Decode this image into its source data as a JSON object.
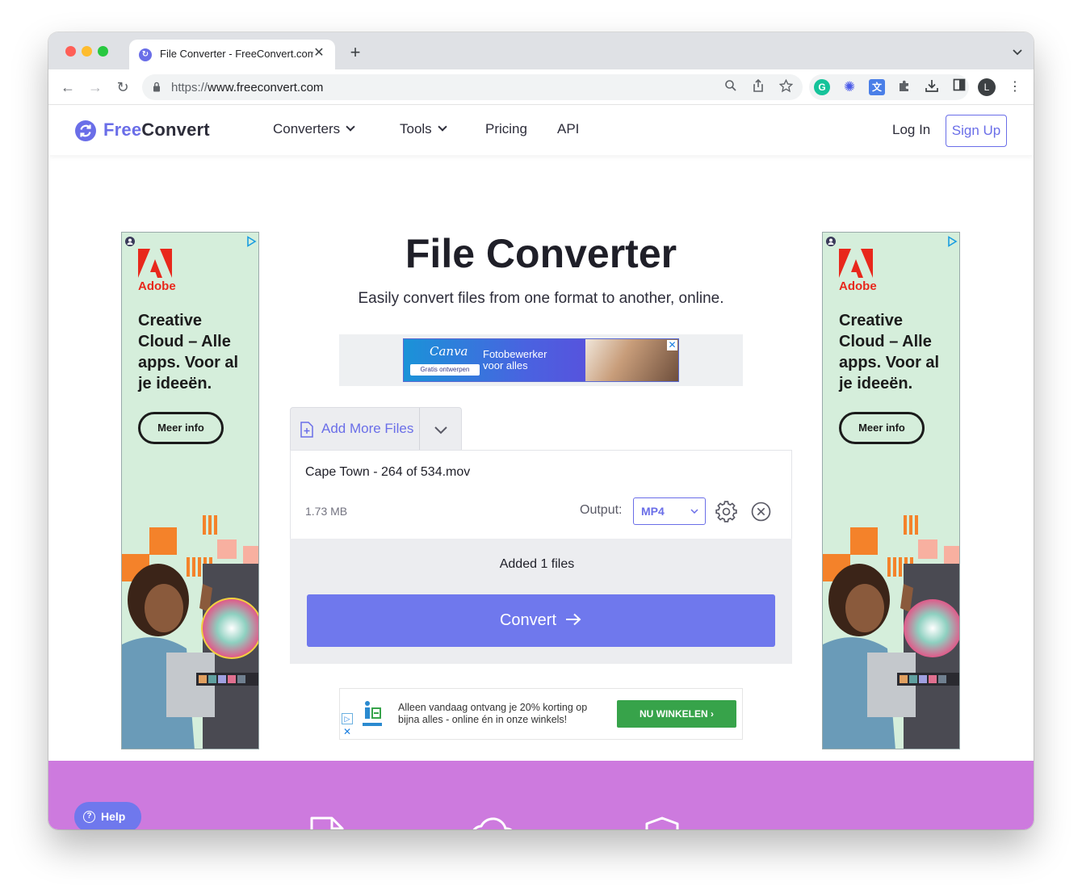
{
  "browser": {
    "tab_title": "File Converter - FreeConvert.com",
    "url_scheme": "https://",
    "url_host": "www.freeconvert.com",
    "avatar_initial": "L"
  },
  "header": {
    "logo_free": "Free",
    "logo_convert": "Convert",
    "nav": {
      "converters": "Converters",
      "tools": "Tools",
      "pricing": "Pricing",
      "api": "API"
    },
    "login": "Log In",
    "signup": "Sign Up"
  },
  "hero": {
    "title": "File Converter",
    "subtitle": "Easily convert files from one format to another, online."
  },
  "top_banner_ad": {
    "brand": "Canva",
    "badge": "Gratis ontwerpen",
    "line1": "Fotobewerker",
    "line2": "voor alles"
  },
  "side_ad": {
    "brand": "Adobe",
    "headline": "Creative Cloud – Alle apps. Voor al je ideeën.",
    "cta": "Meer info"
  },
  "converter": {
    "add_more_label": "Add More Files",
    "file_name": "Cape Town - 264 of 534.mov",
    "file_size": "1.73 MB",
    "output_label": "Output:",
    "output_value": "MP4",
    "added_text": "Added 1 files",
    "convert_label": "Convert"
  },
  "bottom_ad": {
    "text": "Alleen vandaag ontvang je 20% korting op bijna alles - online én in onze winkels!",
    "cta": "NU WINKELEN"
  },
  "footer": {
    "help_label": "Help"
  },
  "colors": {
    "accent": "#6a6ee8",
    "convert_button": "#6f78ed",
    "purple_section": "#cd7ade",
    "ad_green": "#37a34a"
  }
}
